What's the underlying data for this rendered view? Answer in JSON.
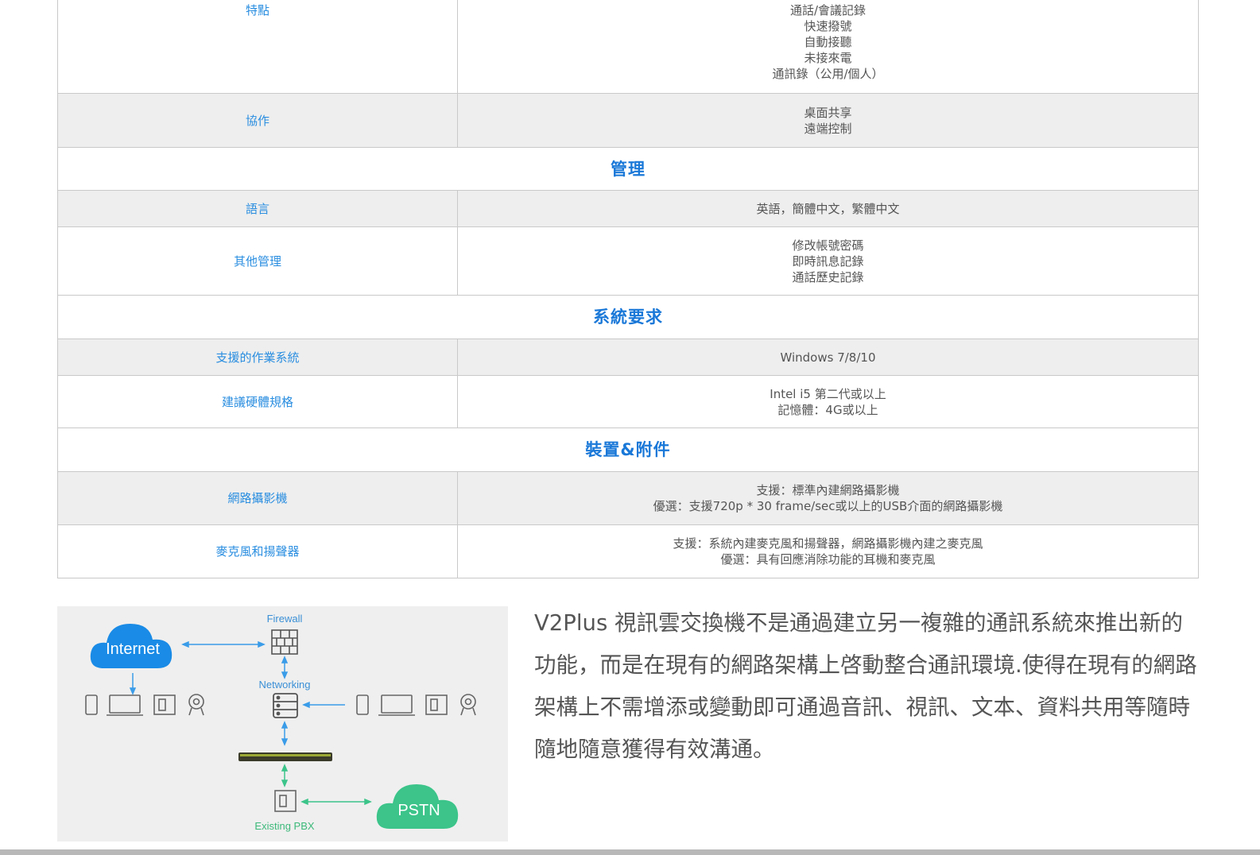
{
  "table": {
    "rows": [
      {
        "type": "row",
        "shaded": false,
        "cls": "r-feat",
        "label": "特點",
        "values": [
          "通話/會議記錄",
          "快速撥號",
          "自動接聽",
          "未接來電",
          "通訊錄（公用/個人）"
        ]
      },
      {
        "type": "row",
        "shaded": true,
        "cls": "r-col",
        "label": "協作",
        "values": [
          "桌面共享",
          "遠端控制"
        ]
      },
      {
        "type": "section",
        "cls": "r-sec",
        "title": "管理"
      },
      {
        "type": "row",
        "shaded": true,
        "cls": "r-lang",
        "label": "語言",
        "values": [
          "英語，簡體中文，繁體中文"
        ]
      },
      {
        "type": "row",
        "shaded": false,
        "cls": "r-other",
        "label": "其他管理",
        "values": [
          "修改帳號密碼",
          "即時訊息記錄",
          "通話歷史記錄"
        ]
      },
      {
        "type": "section",
        "cls": "r-sec2",
        "title": "系統要求"
      },
      {
        "type": "row",
        "shaded": true,
        "cls": "r-os",
        "label": "支援的作業系統",
        "values": [
          "Windows 7/8/10"
        ]
      },
      {
        "type": "row",
        "shaded": false,
        "cls": "r-hw",
        "label": "建議硬體規格",
        "values": [
          "Intel i5 第二代或以上",
          "記憶體：4G或以上"
        ]
      },
      {
        "type": "section",
        "cls": "r-sec3",
        "title": "裝置&附件"
      },
      {
        "type": "row",
        "shaded": true,
        "cls": "r-cam",
        "label": "網路攝影機",
        "values": [
          "支援：標準內建網路攝影機",
          "優選：支援720p * 30 frame/sec或以上的USB介面的網路攝影機"
        ]
      },
      {
        "type": "row",
        "shaded": false,
        "cls": "r-mic",
        "label": "麥克風和揚聲器",
        "values": [
          "支援：系統內建麥克風和揚聲器，網路攝影機內建之麥克風",
          "優選：具有回應消除功能的耳機和麥克風"
        ]
      }
    ]
  },
  "diagram": {
    "internet": "Internet",
    "firewall": "Firewall",
    "networking": "Networking",
    "pstn": "PSTN",
    "existing_pbx": "Existing PBX",
    "colors": {
      "cloud": "#1a8be6",
      "cloud_green": "#3cc48a",
      "arrow": "#3a9ce8",
      "green_arrow": "#3cc48a",
      "label": "#3a8fd6",
      "label_green": "#3cb97a",
      "device": "#666666"
    }
  },
  "description": {
    "text": "V2Plus 視訊雲交換機不是通過建立另一複雜的通訊系統來推出新的功能，而是在現有的網路架構上啓動整合通訊環境.使得在現有的網路架構上不需增添或變動即可通過音訊、視訊、文本、資料共用等隨時隨地隨意獲得有效溝通。"
  }
}
